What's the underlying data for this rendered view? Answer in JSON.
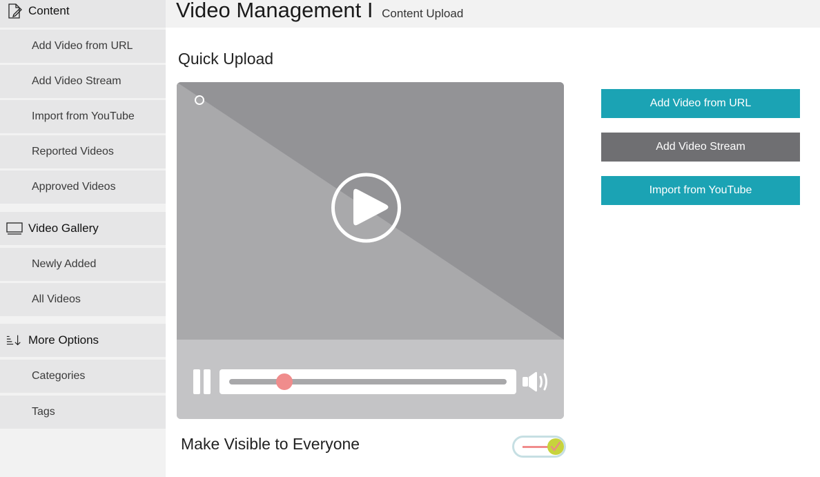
{
  "header": {
    "title": "Video Management I",
    "subtitle": "Content Upload"
  },
  "sidebar": {
    "sections": [
      {
        "label": "Content",
        "icon": "document-edit-icon",
        "items": [
          {
            "label": "Add Video from URL"
          },
          {
            "label": "Add Video Stream"
          },
          {
            "label": "Import from YouTube"
          },
          {
            "label": "Reported Videos"
          },
          {
            "label": "Approved Videos"
          }
        ]
      },
      {
        "label": "Video Gallery",
        "icon": "monitor-icon",
        "items": [
          {
            "label": "Newly Added"
          },
          {
            "label": "All Videos"
          }
        ]
      },
      {
        "label": "More Options",
        "icon": "sort-descending-icon",
        "items": [
          {
            "label": "Categories"
          },
          {
            "label": "Tags"
          }
        ]
      }
    ]
  },
  "main": {
    "section_title": "Quick Upload",
    "player": {
      "icons": [
        "play-icon",
        "pause-icon",
        "volume-icon"
      ],
      "progress": 0.2
    },
    "actions": [
      {
        "label": "Add Video from URL",
        "color": "#1ba3b4"
      },
      {
        "label": "Add Video Stream",
        "color": "#6f6f72"
      },
      {
        "label": "Import from YouTube",
        "color": "#1ba3b4"
      }
    ],
    "visibility": {
      "label": "Make Visible to Everyone",
      "enabled": true
    }
  },
  "colors": {
    "accent": "#1ba3b4",
    "secondary": "#6f6f72",
    "sidebar_bg": "#e6e6e7",
    "slider_thumb": "#f08c8c",
    "toggle_knob": "#c7d33c"
  }
}
